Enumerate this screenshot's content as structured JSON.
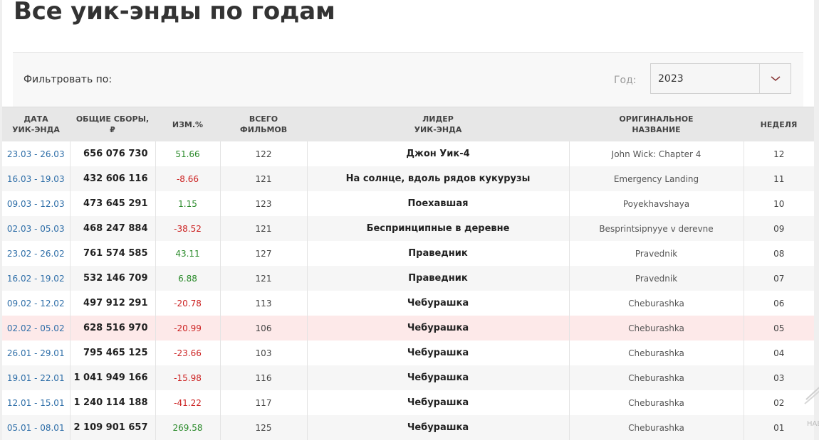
{
  "title": "Все уик-энды по годам",
  "filter": {
    "label": "Фильтровать по:",
    "year_label": "Год:",
    "year_value": "2023"
  },
  "table": {
    "headers": [
      [
        "ДАТА",
        "УИК-ЭНДА"
      ],
      [
        "ОБЩИЕ СБОРЫ,",
        "₽"
      ],
      [
        "ИЗМ.%"
      ],
      [
        "ВСЕГО",
        "ФИЛЬМОВ"
      ],
      [
        "ЛИДЕР",
        "УИК-ЭНДА"
      ],
      [
        "ОРИГИНАЛЬНОЕ",
        "НАЗВАНИЕ"
      ],
      [
        "НЕДЕЛЯ"
      ]
    ],
    "rows": [
      {
        "date": "23.03 - 26.03",
        "gross": "656 076 730",
        "change": "51.66",
        "trend": "up",
        "films": "122",
        "leader": "Джон Уик-4",
        "original": "John Wick: Chapter 4",
        "week": "12"
      },
      {
        "date": "16.03 - 19.03",
        "gross": "432 606 116",
        "change": "-8.66",
        "trend": "down",
        "films": "121",
        "leader": "На солнце, вдоль рядов кукурузы",
        "original": "Emergency Landing",
        "week": "11"
      },
      {
        "date": "09.03 - 12.03",
        "gross": "473 645 291",
        "change": "1.15",
        "trend": "up",
        "films": "123",
        "leader": "Поехавшая",
        "original": "Poyekhavshaya",
        "week": "10"
      },
      {
        "date": "02.03 - 05.03",
        "gross": "468 247 884",
        "change": "-38.52",
        "trend": "down",
        "films": "121",
        "leader": "Беспринципные в деревне",
        "original": "Besprintsipnyye v derevne",
        "week": "09"
      },
      {
        "date": "23.02 - 26.02",
        "gross": "761 574 585",
        "change": "43.11",
        "trend": "up",
        "films": "127",
        "leader": "Праведник",
        "original": "Pravednik",
        "week": "08"
      },
      {
        "date": "16.02 - 19.02",
        "gross": "532 146 709",
        "change": "6.88",
        "trend": "up",
        "films": "121",
        "leader": "Праведник",
        "original": "Pravednik",
        "week": "07"
      },
      {
        "date": "09.02 - 12.02",
        "gross": "497 912 291",
        "change": "-20.78",
        "trend": "down",
        "films": "113",
        "leader": "Чебурашка",
        "original": "Cheburashka",
        "week": "06"
      },
      {
        "date": "02.02 - 05.02",
        "gross": "628 516 970",
        "change": "-20.99",
        "trend": "down",
        "films": "106",
        "leader": "Чебурашка",
        "original": "Cheburashka",
        "week": "05"
      },
      {
        "date": "26.01 - 29.01",
        "gross": "795 465 125",
        "change": "-23.66",
        "trend": "down",
        "films": "103",
        "leader": "Чебурашка",
        "original": "Cheburashka",
        "week": "04"
      },
      {
        "date": "19.01 - 22.01",
        "gross": "1 041 949 166",
        "change": "-15.98",
        "trend": "down",
        "films": "116",
        "leader": "Чебурашка",
        "original": "Cheburashka",
        "week": "03"
      },
      {
        "date": "12.01 - 15.01",
        "gross": "1 240 114 188",
        "change": "-41.22",
        "trend": "down",
        "films": "117",
        "leader": "Чебурашка",
        "original": "Cheburashka",
        "week": "02"
      },
      {
        "date": "05.01 - 08.01",
        "gross": "2 109 901 657",
        "change": "269.58",
        "trend": "up",
        "films": "125",
        "leader": "Чебурашка",
        "original": "Cheburashka",
        "week": "01"
      }
    ],
    "highlighted_row": 7
  },
  "side_text": "НАВ",
  "colors": {
    "positive": "#2a8a2a",
    "negative": "#cc2222",
    "date_link": "#2e6ea8",
    "chevron": "#8a3a3a",
    "highlight_row": "#fde9e9"
  },
  "icons": {
    "year_dropdown": "chevron-down-icon"
  }
}
